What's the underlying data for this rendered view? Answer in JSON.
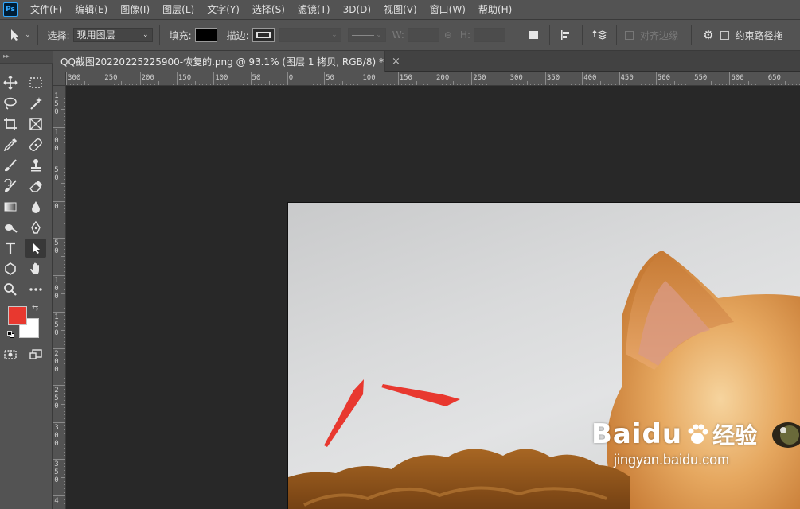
{
  "app": {
    "logo": "Ps"
  },
  "menu": [
    "文件(F)",
    "编辑(E)",
    "图像(I)",
    "图层(L)",
    "文字(Y)",
    "选择(S)",
    "滤镜(T)",
    "3D(D)",
    "视图(V)",
    "窗口(W)",
    "帮助(H)"
  ],
  "options": {
    "select_label": "选择:",
    "select_value": "现用图层",
    "fill_label": "填充:",
    "fill_color": "#000000",
    "stroke_label": "描边:",
    "w_label": "W:",
    "h_label": "H:",
    "align_edges_label": "对齐边缘",
    "constrain_label": "约束路径拖"
  },
  "document": {
    "tab_title": "QQ截图20220225225900-恢复的.png @ 93.1% (图层 1 拷贝, RGB/8) *",
    "close_glyph": "×"
  },
  "toolbar": {
    "grip": "▸▸",
    "foreground_color": "#e8382f",
    "background_color": "#ffffff"
  },
  "ruler_top": [
    "300",
    "250",
    "200",
    "150",
    "100",
    "50",
    "0",
    "50",
    "100",
    "150",
    "200",
    "250",
    "300",
    "350",
    "400",
    "450",
    "500",
    "550",
    "600",
    "650"
  ],
  "ruler_left": [
    "150",
    "100",
    "50",
    "0",
    "50",
    "100",
    "150",
    "200",
    "250",
    "300",
    "350",
    "4"
  ],
  "watermark": {
    "logo_text": "Baidu",
    "logo_cn": "经验",
    "url": "jingyan.baidu.com"
  },
  "colors": {
    "ui_panel": "#535353",
    "canvas_bg": "#282828",
    "arrow": "#e8382f"
  }
}
